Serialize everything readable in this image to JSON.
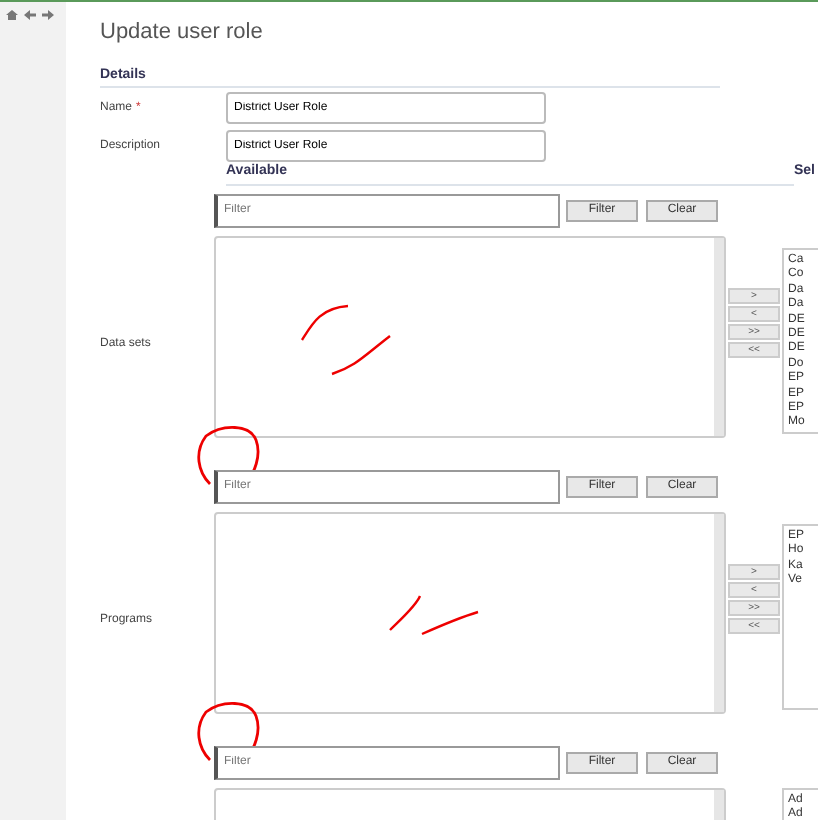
{
  "title": "Update user role",
  "details": {
    "heading": "Details",
    "fields": [
      {
        "label": "Name",
        "required_mark": "*",
        "value": "District User Role"
      },
      {
        "label": "Description",
        "value": "District User Role"
      }
    ]
  },
  "columns": {
    "available": "Available",
    "selected": "Sel"
  },
  "pickers": [
    {
      "label": "Data sets",
      "filter_placeholder": "Filter",
      "filter_button": "Filter",
      "clear_button": "Clear",
      "move_buttons": [
        ">",
        "<",
        ">>",
        "<<"
      ],
      "selected_items": [
        "Ca",
        "Co",
        "Da",
        "Da",
        "DE",
        "DE",
        "DE",
        "Do",
        "EP",
        "EP",
        "EP",
        "Mo"
      ]
    },
    {
      "label": "Programs",
      "filter_placeholder": "Filter",
      "filter_button": "Filter",
      "clear_button": "Clear",
      "move_buttons": [
        ">",
        "<",
        ">>",
        "<<"
      ],
      "selected_items": [
        "EP",
        "Ho",
        "Ka",
        "Ve"
      ]
    },
    {
      "filter_placeholder": "Filter",
      "filter_button": "Filter",
      "clear_button": "Clear",
      "selected_items": [
        "Ad",
        "Ad"
      ]
    }
  ]
}
